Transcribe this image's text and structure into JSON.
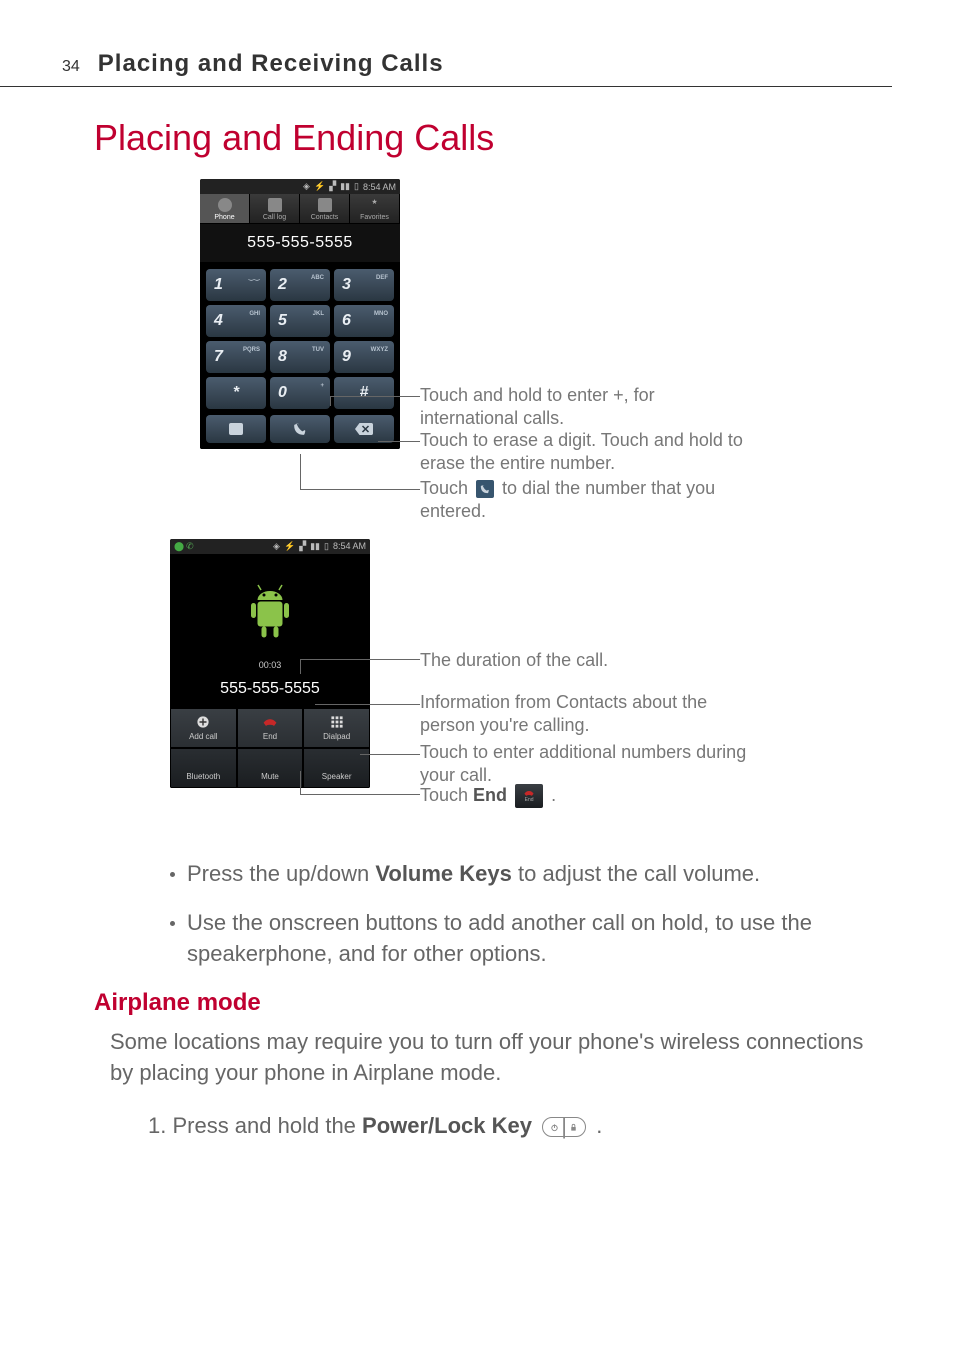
{
  "page": {
    "number": "34",
    "section": "Placing and Receiving Calls"
  },
  "heading": "Placing and Ending Calls",
  "dialer": {
    "time": "8:54 AM",
    "tabs": {
      "phone": "Phone",
      "calllog": "Call log",
      "contacts": "Contacts",
      "favorites": "Favorites"
    },
    "entered": "555-555-5555",
    "keys": [
      {
        "num": "1",
        "letters": ""
      },
      {
        "num": "2",
        "letters": "ABC"
      },
      {
        "num": "3",
        "letters": "DEF"
      },
      {
        "num": "4",
        "letters": "GHI"
      },
      {
        "num": "5",
        "letters": "JKL"
      },
      {
        "num": "6",
        "letters": "MNO"
      },
      {
        "num": "7",
        "letters": "PQRS"
      },
      {
        "num": "8",
        "letters": "TUV"
      },
      {
        "num": "9",
        "letters": "WXYZ"
      },
      {
        "num": "*",
        "letters": ""
      },
      {
        "num": "0",
        "letters": "+"
      },
      {
        "num": "#",
        "letters": ""
      }
    ],
    "voicemail_glyph": "⏝⏝"
  },
  "callouts_dialer": {
    "zero": "Touch and hold to enter +, for international calls.",
    "erase": "Touch to erase a digit. Touch and hold to erase the entire number.",
    "dial_pre": "Touch ",
    "dial_post": " to dial the number that you entered."
  },
  "incall": {
    "time": "8:54 AM",
    "duration": "00:03",
    "number": "555-555-5555",
    "buttons": {
      "add": "Add call",
      "end": "End",
      "dialpad": "Dialpad",
      "bt": "Bluetooth",
      "mute": "Mute",
      "speaker": "Speaker"
    }
  },
  "callouts_incall": {
    "duration": "The duration of the call.",
    "info": "Information from Contacts about the person you're calling.",
    "dialpad": "Touch to enter additional numbers during your call.",
    "end_pre": "Touch ",
    "end_label": "End",
    "end_post": " ."
  },
  "bullets": {
    "volume_pre": "Press the up/down ",
    "volume_bold": "Volume Keys",
    "volume_post": " to adjust the call volume.",
    "onscreen": "Use the onscreen buttons to add another call on hold, to use the speakerphone, and for other options."
  },
  "airplane": {
    "heading": "Airplane mode",
    "para": "Some locations may require you to turn off your phone's wireless connections by placing your phone in Airplane mode.",
    "step_pre": "1. Press and hold the ",
    "step_bold": "Power/Lock Key",
    "step_post": " ."
  },
  "icons": {
    "voicemail": "⏝⏝"
  }
}
